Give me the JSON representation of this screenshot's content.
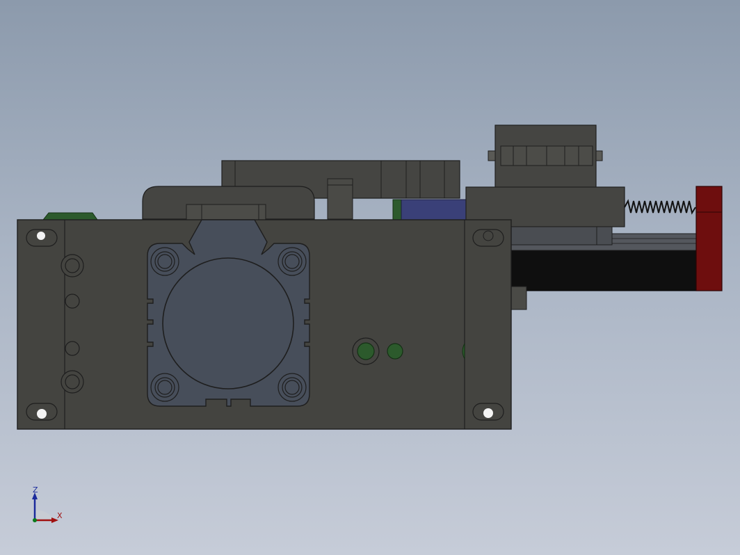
{
  "view": {
    "background_top": "#8c9aac",
    "background_bottom": "#c6ccd8",
    "body_color": "#444440",
    "edge_color": "#1e1e1e"
  },
  "triad": {
    "z_label": "Z",
    "x_label": "X",
    "z_color": "#1a2a9c",
    "x_color": "#a01010"
  }
}
